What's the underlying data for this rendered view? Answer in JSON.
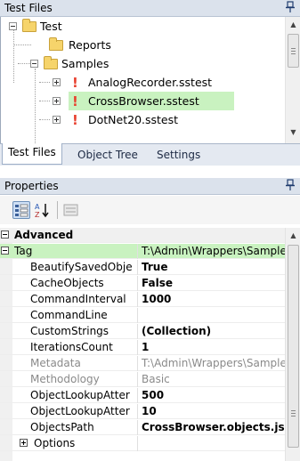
{
  "test_files_panel": {
    "title": "Test Files",
    "pin_icon": "pin-icon",
    "tree": [
      {
        "label": "Test",
        "kind": "folder",
        "expanded": true
      },
      {
        "label": "Reports",
        "kind": "folder"
      },
      {
        "label": "Samples",
        "kind": "folder",
        "expanded": true
      },
      {
        "label": "AnalogRecorder.sstest",
        "kind": "test"
      },
      {
        "label": "CrossBrowser.sstest",
        "kind": "test",
        "selected": true
      },
      {
        "label": "DotNet20.sstest",
        "kind": "test"
      }
    ]
  },
  "tabs": [
    {
      "label": "Test Files",
      "active": true
    },
    {
      "label": "Object Tree"
    },
    {
      "label": "Settings"
    }
  ],
  "properties_panel": {
    "title": "Properties",
    "pin_icon": "pin-icon",
    "toolbar": {
      "categorized_icon": "categorized-view-icon",
      "alphabetical_icon": "alphabetical-sort-icon",
      "pages_icon": "property-pages-icon"
    },
    "category": "Advanced",
    "rows": [
      {
        "name": "Tag",
        "value": "T:\\Admin\\Wrappers\\Sample",
        "style": "normal",
        "selected": true
      },
      {
        "name": "BeautifySavedObje",
        "value": "True",
        "style": "bold"
      },
      {
        "name": "CacheObjects",
        "value": "False",
        "style": "bold"
      },
      {
        "name": "CommandInterval",
        "value": "1000",
        "style": "bold"
      },
      {
        "name": "CommandLine",
        "value": "",
        "style": "normal"
      },
      {
        "name": "CustomStrings",
        "value": "(Collection)",
        "style": "bold"
      },
      {
        "name": "IterationsCount",
        "value": "1",
        "style": "bold"
      },
      {
        "name": "Metadata",
        "value": "T:\\Admin\\Wrappers\\Sample",
        "style": "gray"
      },
      {
        "name": "Methodology",
        "value": "Basic",
        "style": "gray"
      },
      {
        "name": "ObjectLookupAtter",
        "value": "500",
        "style": "bold"
      },
      {
        "name": "ObjectLookupAtter",
        "value": "10",
        "style": "bold"
      },
      {
        "name": "ObjectsPath",
        "value": "CrossBrowser.objects.js",
        "style": "bold"
      },
      {
        "name": "Options",
        "value": "",
        "style": "normal"
      }
    ]
  }
}
